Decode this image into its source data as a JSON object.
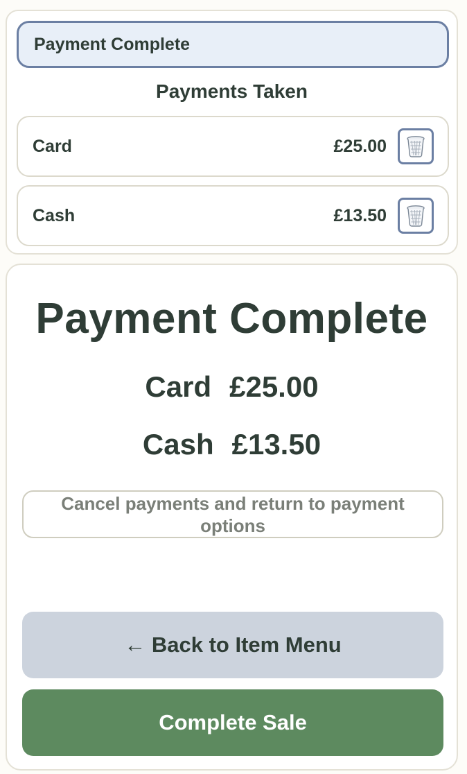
{
  "status_banner": {
    "label": "Payment Complete"
  },
  "payments_section": {
    "heading": "Payments Taken",
    "rows": [
      {
        "method": "Card",
        "amount": "£25.00",
        "delete_icon": "trash-bin-icon"
      },
      {
        "method": "Cash",
        "amount": "£13.50",
        "delete_icon": "trash-bin-icon"
      }
    ]
  },
  "summary": {
    "title": "Payment Complete",
    "lines": [
      {
        "method": "Card",
        "amount": "£25.00"
      },
      {
        "method": "Cash",
        "amount": "£13.50"
      }
    ]
  },
  "actions": {
    "cancel_label": "Cancel payments and return to payment options",
    "back_label": "← Back to Item Menu",
    "complete_label": "Complete Sale"
  },
  "colors": {
    "text": "#2f3d36",
    "banner_bg": "#e8eff8",
    "banner_border": "#6b7fa3",
    "back_button_bg": "#ccd3dd",
    "complete_button_bg": "#5d8a5f",
    "cancel_text": "#7a7f78"
  }
}
